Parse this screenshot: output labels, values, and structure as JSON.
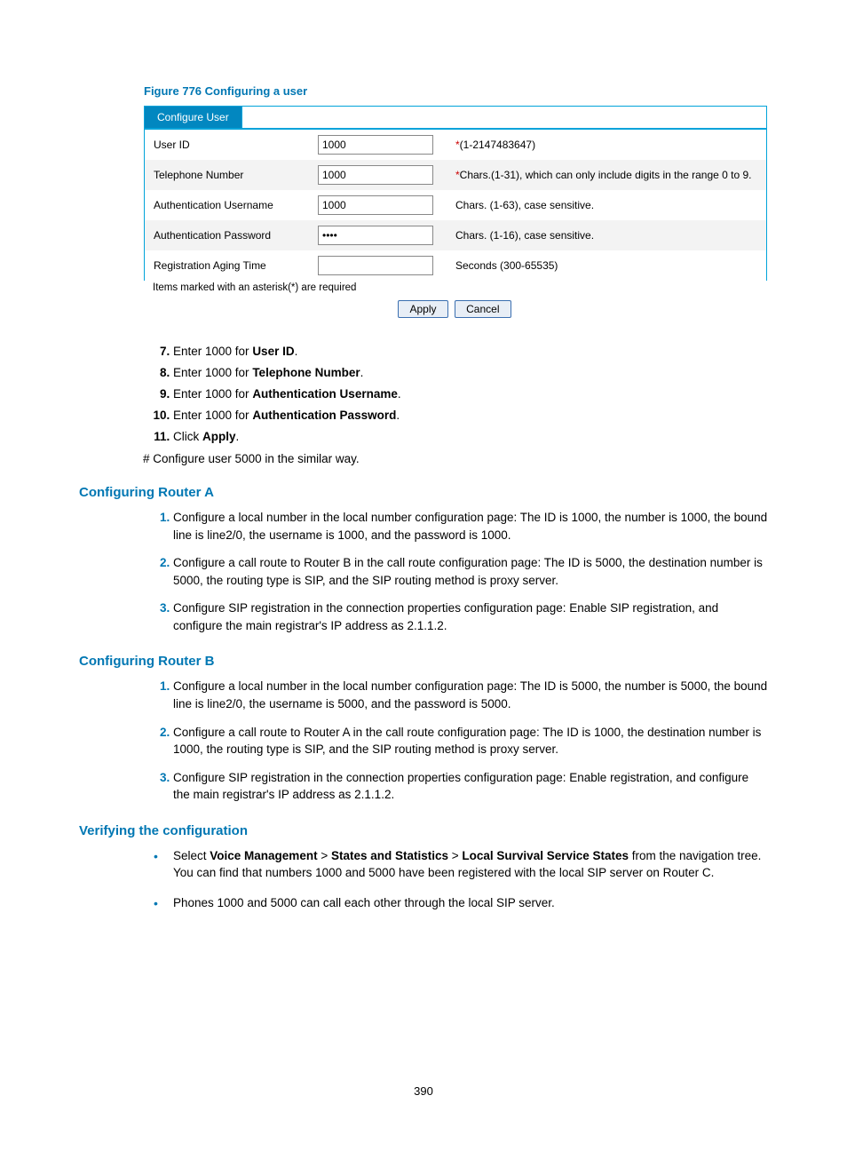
{
  "figure_caption": "Figure 776 Configuring a user",
  "form": {
    "tab": "Configure User",
    "rows": [
      {
        "label": "User ID",
        "value": "1000",
        "hint": "(1-2147483647)",
        "ast": true
      },
      {
        "label": "Telephone Number",
        "value": "1000",
        "hint": "Chars.(1-31), which can only include digits in the range 0 to 9.",
        "ast": true
      },
      {
        "label": "Authentication Username",
        "value": "1000",
        "hint": "Chars. (1-63), case sensitive.",
        "ast": false
      },
      {
        "label": "Authentication Password",
        "value": "●●●●",
        "hint": "Chars. (1-16), case sensitive.",
        "ast": false
      },
      {
        "label": "Registration Aging Time",
        "value": "",
        "hint": "Seconds (300-65535)",
        "ast": false
      }
    ],
    "footnote": "Items marked with an asterisk(*) are required",
    "apply_label": "Apply",
    "cancel_label": "Cancel"
  },
  "steps": {
    "s7_a": "Enter 1000 for ",
    "s7_b": "User ID",
    "s7_c": ".",
    "s8_a": "Enter 1000 for ",
    "s8_b": "Telephone Number",
    "s8_c": ".",
    "s9_a": "Enter 1000 for ",
    "s9_b": "Authentication Username",
    "s9_c": ".",
    "s10_a": "Enter 1000 for ",
    "s10_b": "Authentication Password",
    "s10_c": ".",
    "s11_a": "Click ",
    "s11_b": "Apply",
    "s11_c": "."
  },
  "hash_note": "# Configure user 5000 in the similar way.",
  "sectA": {
    "title": "Configuring Router A",
    "i1": "Configure a local number in the local number configuration page: The ID is 1000, the number is 1000, the bound line is line2/0, the username is 1000, and the password is 1000.",
    "i2": "Configure a call route to Router B in the call route configuration page: The ID is 5000, the destination number is 5000, the routing type is SIP, and the SIP routing method is proxy server.",
    "i3": "Configure SIP registration in the connection properties configuration page: Enable SIP registration, and configure the main registrar's IP address as 2.1.1.2."
  },
  "sectB": {
    "title": "Configuring Router B",
    "i1": "Configure a local number in the local number configuration page: The ID is 5000, the number is 5000, the bound line is line2/0, the username is 5000, and the password is 5000.",
    "i2": "Configure a call route to Router A in the call route configuration page: The ID is 1000, the destination number is 1000, the routing type is SIP, and the SIP routing method is proxy server.",
    "i3": "Configure SIP registration in the connection properties configuration page: Enable registration, and configure the main registrar's IP address as 2.1.1.2."
  },
  "sectV": {
    "title": "Verifying the configuration",
    "b1_a": "Select ",
    "b1_b": "Voice Management",
    "b1_c": " > ",
    "b1_d": "States and Statistics",
    "b1_e": " > ",
    "b1_f": "Local Survival Service States",
    "b1_g": " from the navigation tree. You can find that numbers 1000 and 5000 have been registered with the local SIP server on Router C.",
    "b2": "Phones 1000 and 5000 can call each other through the local SIP server."
  },
  "page_number": "390"
}
